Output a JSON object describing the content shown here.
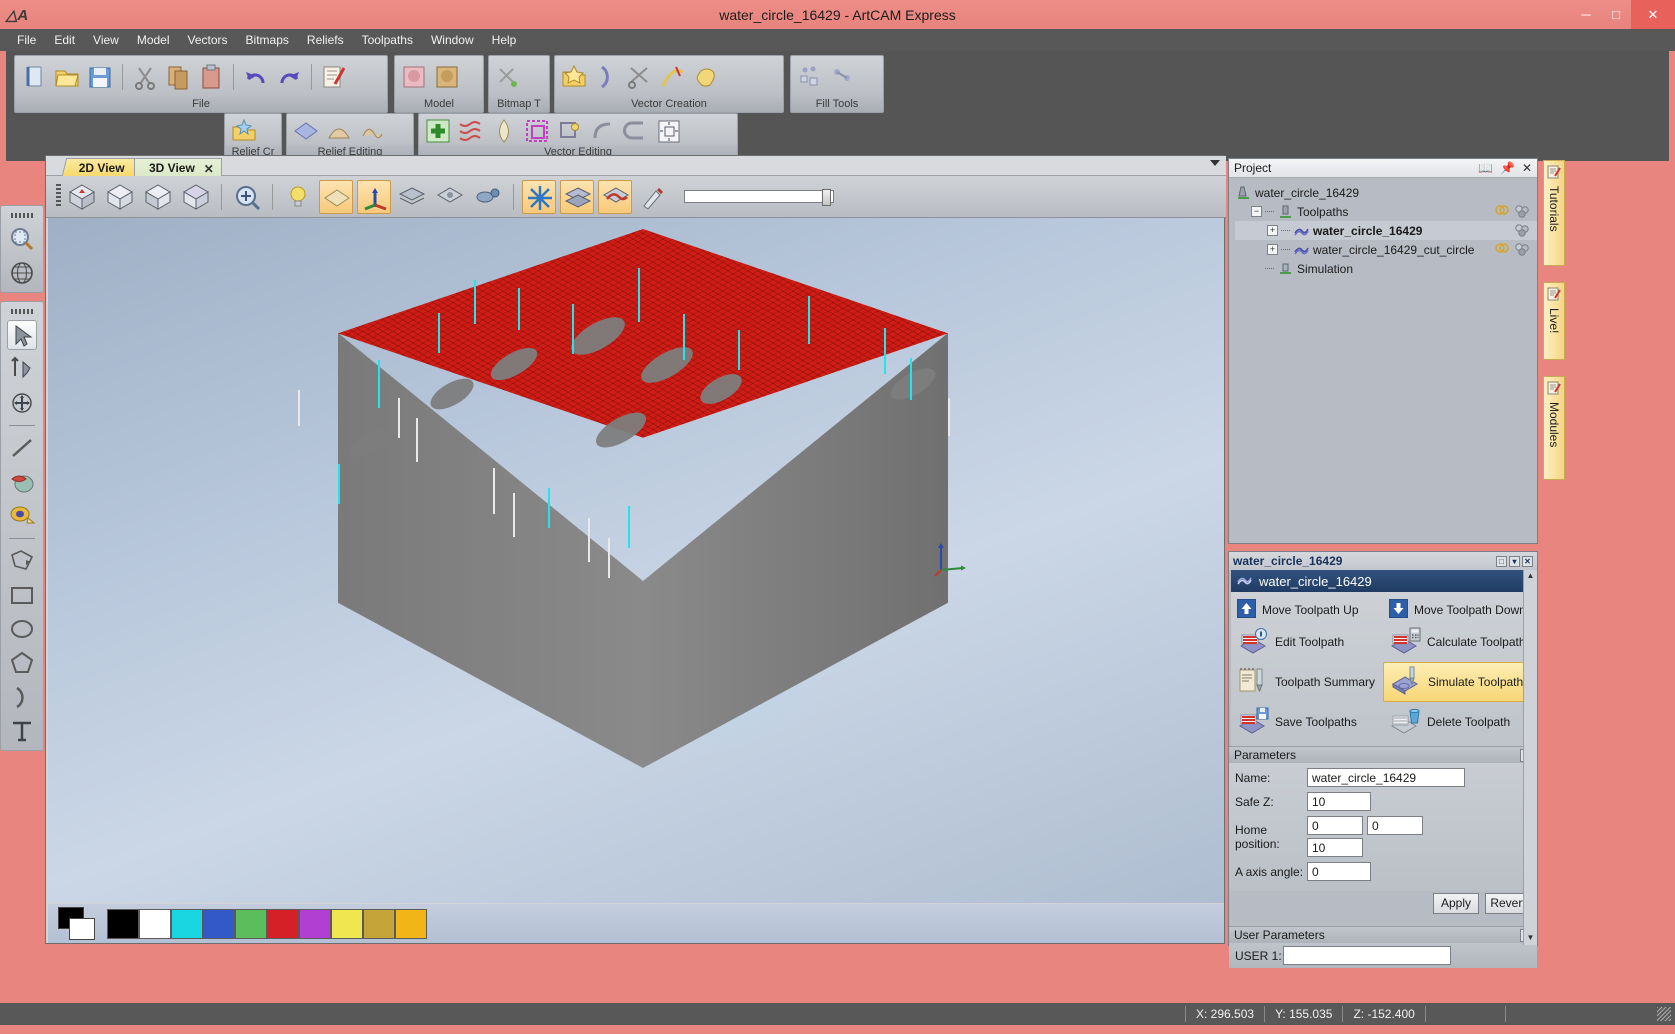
{
  "window": {
    "title": "water_circle_16429 - ArtCAM Express",
    "logo_icon": "artcam-logo-icon",
    "minimize_label": "─",
    "maximize_label": "□",
    "close_label": "✕"
  },
  "menubar": {
    "items": [
      {
        "label": "File"
      },
      {
        "label": "Edit"
      },
      {
        "label": "View"
      },
      {
        "label": "Model"
      },
      {
        "label": "Vectors"
      },
      {
        "label": "Bitmaps"
      },
      {
        "label": "Reliefs"
      },
      {
        "label": "Toolpaths"
      },
      {
        "label": "Window"
      },
      {
        "label": "Help"
      }
    ]
  },
  "ribbon": {
    "groups": [
      {
        "label": "File",
        "icons": [
          "new-model-icon",
          "open-model-icon",
          "save-model-icon",
          "cut-icon",
          "copy-icon",
          "paste-icon",
          "undo-icon",
          "redo-icon",
          "notes-icon"
        ]
      },
      {
        "label": "Model",
        "icons": [
          "model-pink-icon",
          "model-brown-icon"
        ]
      },
      {
        "label": "Bitmap T",
        "icons": [
          "bitmap-to-vector-icon"
        ]
      },
      {
        "label": "Vector Creation",
        "icons": [
          "vector-library-icon",
          "arc-icon",
          "trim-vectors-icon",
          "curve-edit-icon",
          "vector-blend-icon"
        ]
      },
      {
        "label": "Fill Tools",
        "icons": [
          "fill-pattern-icon",
          "fill-tool-icon"
        ]
      },
      {
        "label": "Relief Cr",
        "icons": [
          "relief-library-icon"
        ]
      },
      {
        "label": "Relief Editing",
        "icons": [
          "relief-plane-icon",
          "relief-shape-icon",
          "relief-sculpt-icon"
        ]
      },
      {
        "label": "Vector Editing",
        "icons": [
          "add-vector-icon",
          "node-edit-icon",
          "offset-vector-icon",
          "transform-vector-icon",
          "weld-vector-icon",
          "fillet-icon",
          "join-vectors-icon",
          "align-vectors-icon"
        ]
      }
    ]
  },
  "document": {
    "tabs": [
      {
        "label": "2D View",
        "active": false,
        "closable": false
      },
      {
        "label": "3D View",
        "active": true,
        "closable": true,
        "close_label": "✕"
      }
    ],
    "view_toolbar": {
      "icons": [
        "iso-view-icon",
        "plan-view-icon",
        "front-view-icon",
        "side-view-icon",
        "zoom-icon",
        "light-icon",
        "shade-relief-icon",
        "triple-view-icon",
        "layer-view-icon",
        "material-icon",
        "toolpath-preview-icon",
        "simulation-icon",
        "composite-relief-icon",
        "toolpath-shade-icon",
        "paint-icon"
      ],
      "slider_value": "100"
    },
    "palette": {
      "primary_color": "#000000",
      "secondary_color": "#ffffff",
      "swatches": [
        "#000000",
        "#ffffff",
        "#1ad6e0",
        "#3358c7",
        "#5bbd5b",
        "#d62027",
        "#b13fd1",
        "#f0e650",
        "#c5a53a",
        "#f2b517"
      ]
    }
  },
  "left_toolbar": {
    "groups": [
      {
        "tools": [
          {
            "icon": "zoom-area-icon",
            "selected": false
          },
          {
            "icon": "globe-view-icon",
            "selected": false
          }
        ]
      },
      {
        "tools": [
          {
            "icon": "select-arrow-icon",
            "selected": true
          },
          {
            "icon": "node-edit-arrow-icon",
            "selected": false
          },
          {
            "icon": "transform-move-icon",
            "selected": false
          },
          {
            "icon": "line-tool-icon",
            "selected": false
          },
          {
            "icon": "paint-bucket-icon",
            "selected": false
          },
          {
            "icon": "measure-tape-icon",
            "selected": false
          },
          {
            "icon": "polyline-tool-icon",
            "selected": false
          },
          {
            "icon": "rectangle-tool-icon",
            "selected": false
          },
          {
            "icon": "ellipse-tool-icon",
            "selected": false
          },
          {
            "icon": "polygon-tool-icon",
            "selected": false
          },
          {
            "icon": "arc-tool-icon",
            "selected": false
          },
          {
            "icon": "text-tool-icon",
            "selected": false
          }
        ]
      }
    ]
  },
  "project_panel": {
    "title": "Project",
    "header_icons": [
      "book-icon",
      "pin-icon",
      "close-icon"
    ],
    "tree": [
      {
        "label": "water_circle_16429",
        "depth": 0,
        "icon": "artcam-model-icon",
        "bold": false,
        "selected": false,
        "expander": "",
        "row_icons": []
      },
      {
        "label": "Toolpaths",
        "depth": 1,
        "icon": "toolpaths-folder-icon",
        "bold": false,
        "selected": false,
        "expander": "−",
        "row_icons": [
          "lightbulb-icon",
          "tool-icon"
        ]
      },
      {
        "label": "water_circle_16429",
        "depth": 2,
        "icon": "toolpath-icon",
        "bold": true,
        "selected": true,
        "expander": "+",
        "row_icons": [
          "tool-icon"
        ]
      },
      {
        "label": "water_circle_16429_cut_circle",
        "depth": 2,
        "icon": "toolpath-icon",
        "bold": false,
        "selected": false,
        "expander": "+",
        "row_icons": [
          "lightbulb-icon",
          "tool-icon"
        ]
      },
      {
        "label": "Simulation",
        "depth": 1,
        "icon": "simulation-icon",
        "bold": false,
        "selected": false,
        "expander": "",
        "row_icons": []
      }
    ]
  },
  "toolpath_panel": {
    "header_title": "water_circle_16429",
    "header_buttons": [
      "restore-button",
      "minimize-button",
      "close-button"
    ],
    "selected_toolpath": "water_circle_16429",
    "selected_icon": "toolpath-icon",
    "operations": [
      {
        "label": "Move Toolpath Up",
        "icon": "arrow-up-icon",
        "highlighted": false,
        "small": true
      },
      {
        "label": "Move Toolpath Down",
        "icon": "arrow-down-icon",
        "highlighted": false,
        "small": true
      },
      {
        "label": "Edit Toolpath",
        "icon": "edit-toolpath-icon",
        "highlighted": false,
        "small": false
      },
      {
        "label": "Calculate Toolpath",
        "icon": "calculate-toolpath-icon",
        "highlighted": false,
        "small": false
      },
      {
        "label": "Toolpath Summary",
        "icon": "toolpath-summary-icon",
        "highlighted": false,
        "small": false
      },
      {
        "label": "Simulate Toolpath",
        "icon": "simulate-toolpath-icon",
        "highlighted": true,
        "small": false
      },
      {
        "label": "Save Toolpaths",
        "icon": "save-toolpaths-icon",
        "highlighted": false,
        "small": false
      },
      {
        "label": "Delete Toolpath",
        "icon": "delete-toolpath-icon",
        "highlighted": false,
        "small": false
      }
    ],
    "parameters_title": "Parameters",
    "fields": {
      "name_label": "Name:",
      "name_value": "water_circle_16429",
      "safez_label": "Safe Z:",
      "safez_value": "10",
      "home_label": "Home position:",
      "home_x": "0",
      "home_y": "0",
      "home_z": "10",
      "aaxis_label": "A axis angle:",
      "aaxis_value": "0"
    },
    "apply_label": "Apply",
    "revert_label": "Revert",
    "user_parameters_title": "User Parameters",
    "user1_label": "USER 1:",
    "user1_value": ""
  },
  "side_tabs": [
    {
      "label": "Tutorials",
      "icon": "tutorials-icon"
    },
    {
      "label": "Live!",
      "icon": "live-icon"
    },
    {
      "label": "Modules",
      "icon": "modules-icon"
    }
  ],
  "statusbar": {
    "x": "X: 296.503",
    "y": "Y: 155.035",
    "z": "Z: -152.400"
  },
  "colors": {
    "titlebar": "#e8857f",
    "menubar": "#585858",
    "material_top": "#d01c14",
    "material_side": "#808080",
    "toolpath_tick": "#21e4ef",
    "highlight": "#f7d676",
    "selection": "#31517e"
  }
}
